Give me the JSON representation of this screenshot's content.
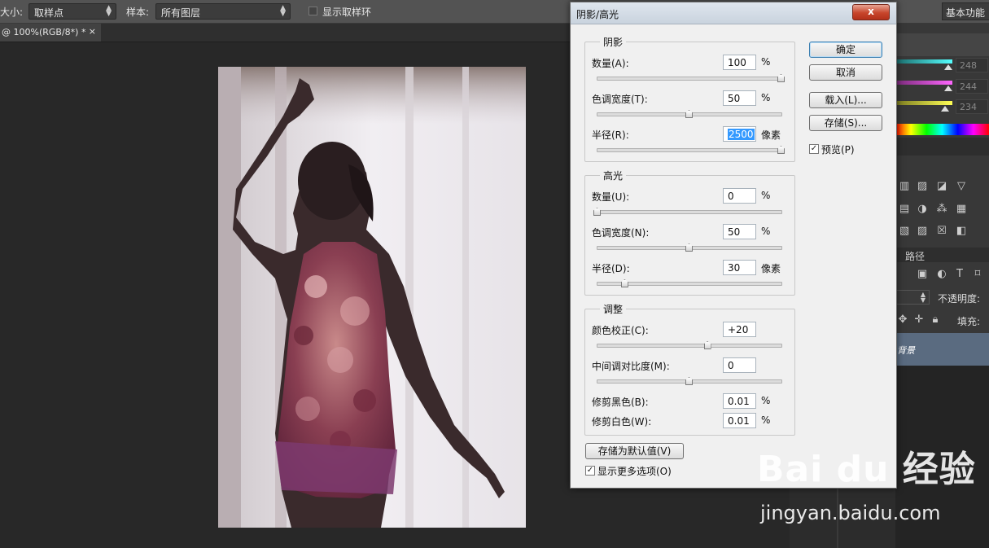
{
  "options_bar": {
    "size_label": "大小:",
    "size_value": "取样点",
    "sample_label": "样本:",
    "sample_value": "所有图层",
    "show_ring_label": "显示取样环",
    "workspace": "基本功能"
  },
  "document_tab": {
    "title": "@ 100%(RGB/8*) *",
    "close": "×"
  },
  "right_panel": {
    "color_values": [
      "248",
      "244",
      "234"
    ],
    "paths_tab": "路径",
    "opacity_label": "不透明度:",
    "fill_label": "填充:",
    "layer_name": "背景"
  },
  "dialog": {
    "title": "阴影/高光",
    "close_symbol": "x",
    "shadows": {
      "title": "阴影",
      "amount_label": "数量(A):",
      "amount_value": "100",
      "amount_unit": "%",
      "amount_pct": 100,
      "tonal_label": "色调宽度(T):",
      "tonal_value": "50",
      "tonal_unit": "%",
      "tonal_pct": 50,
      "radius_label": "半径(R):",
      "radius_value": "2500",
      "radius_unit": "像素",
      "radius_pct": 100
    },
    "highlights": {
      "title": "高光",
      "amount_label": "数量(U):",
      "amount_value": "0",
      "amount_unit": "%",
      "amount_pct": 0,
      "tonal_label": "色调宽度(N):",
      "tonal_value": "50",
      "tonal_unit": "%",
      "tonal_pct": 50,
      "radius_label": "半径(D):",
      "radius_value": "30",
      "radius_unit": "像素",
      "radius_pct": 15
    },
    "adjustments": {
      "title": "调整",
      "color_label": "颜色校正(C):",
      "color_value": "+20",
      "color_pct": 60,
      "midtone_label": "中间调对比度(M):",
      "midtone_value": "0",
      "midtone_pct": 50,
      "black_clip_label": "修剪黑色(B):",
      "black_clip_value": "0.01",
      "black_clip_unit": "%",
      "white_clip_label": "修剪白色(W):",
      "white_clip_value": "0.01",
      "white_clip_unit": "%"
    },
    "buttons": {
      "ok": "确定",
      "cancel": "取消",
      "load": "载入(L)...",
      "save": "存储(S)...",
      "save_default": "存储为默认值(V)"
    },
    "preview_label": "预览(P)",
    "preview_checked": true,
    "more_options_label": "显示更多选项(O)",
    "more_options_checked": true
  },
  "watermark": {
    "logo_text": "Bai du 经验",
    "url": "jingyan.baidu.com"
  }
}
